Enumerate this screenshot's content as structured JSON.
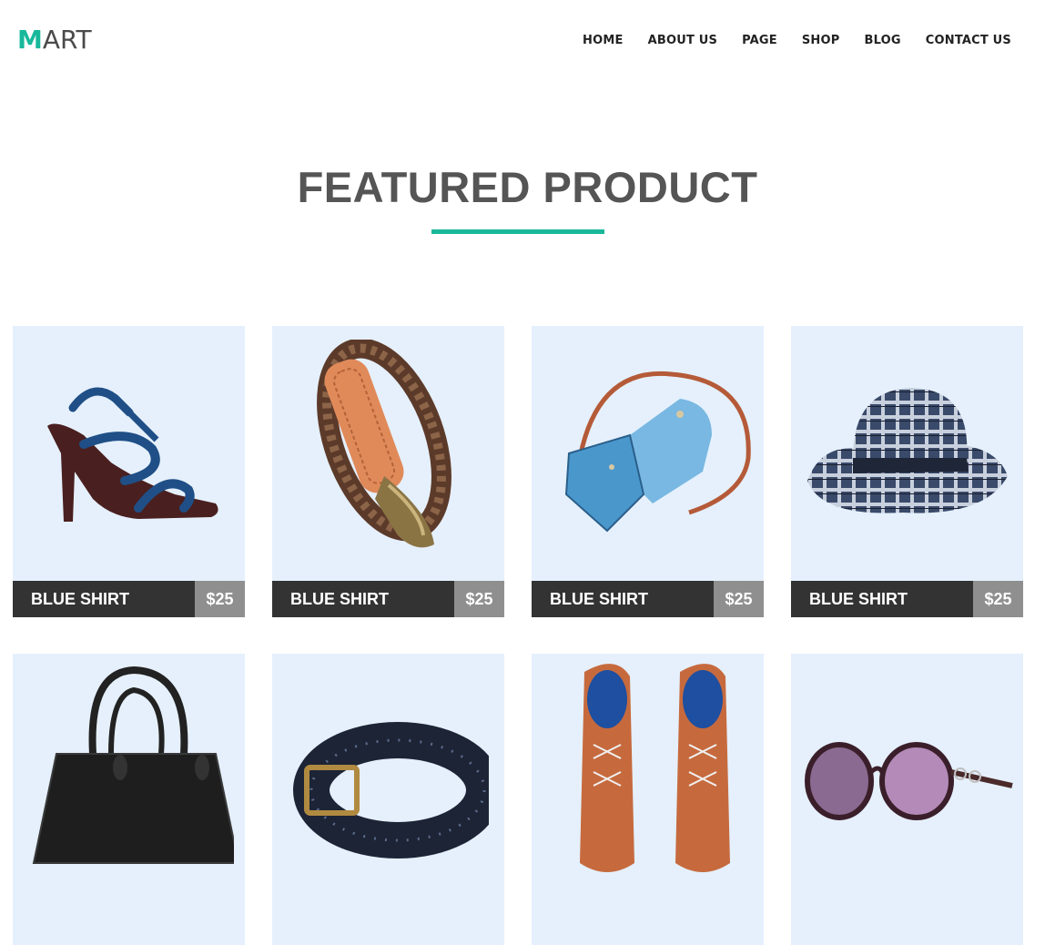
{
  "brand": {
    "first_letter": "M",
    "rest": "ART"
  },
  "nav": [
    "HOME",
    "ABOUT US",
    "PAGE",
    "SHOP",
    "BLOG",
    "CONTACT US"
  ],
  "section_title": "FEATURED PRODUCT",
  "colors": {
    "accent": "#19b89b",
    "card_bg": "#e5f0fc",
    "label_bar": "#333333",
    "price_bg": "#8f8f8f"
  },
  "products": [
    {
      "name": "BLUE SHIRT",
      "price": "$25",
      "icon": "sandal-icon"
    },
    {
      "name": "BLUE SHIRT",
      "price": "$25",
      "icon": "braided-belt-icon"
    },
    {
      "name": "BLUE SHIRT",
      "price": "$25",
      "icon": "shoulder-bag-icon"
    },
    {
      "name": "BLUE SHIRT",
      "price": "$25",
      "icon": "plaid-hat-icon"
    },
    {
      "name": "",
      "price": "",
      "icon": "handbag-icon"
    },
    {
      "name": "",
      "price": "",
      "icon": "leather-belt-icon"
    },
    {
      "name": "",
      "price": "",
      "icon": "shoes-icon"
    },
    {
      "name": "",
      "price": "",
      "icon": "sunglasses-icon"
    }
  ]
}
